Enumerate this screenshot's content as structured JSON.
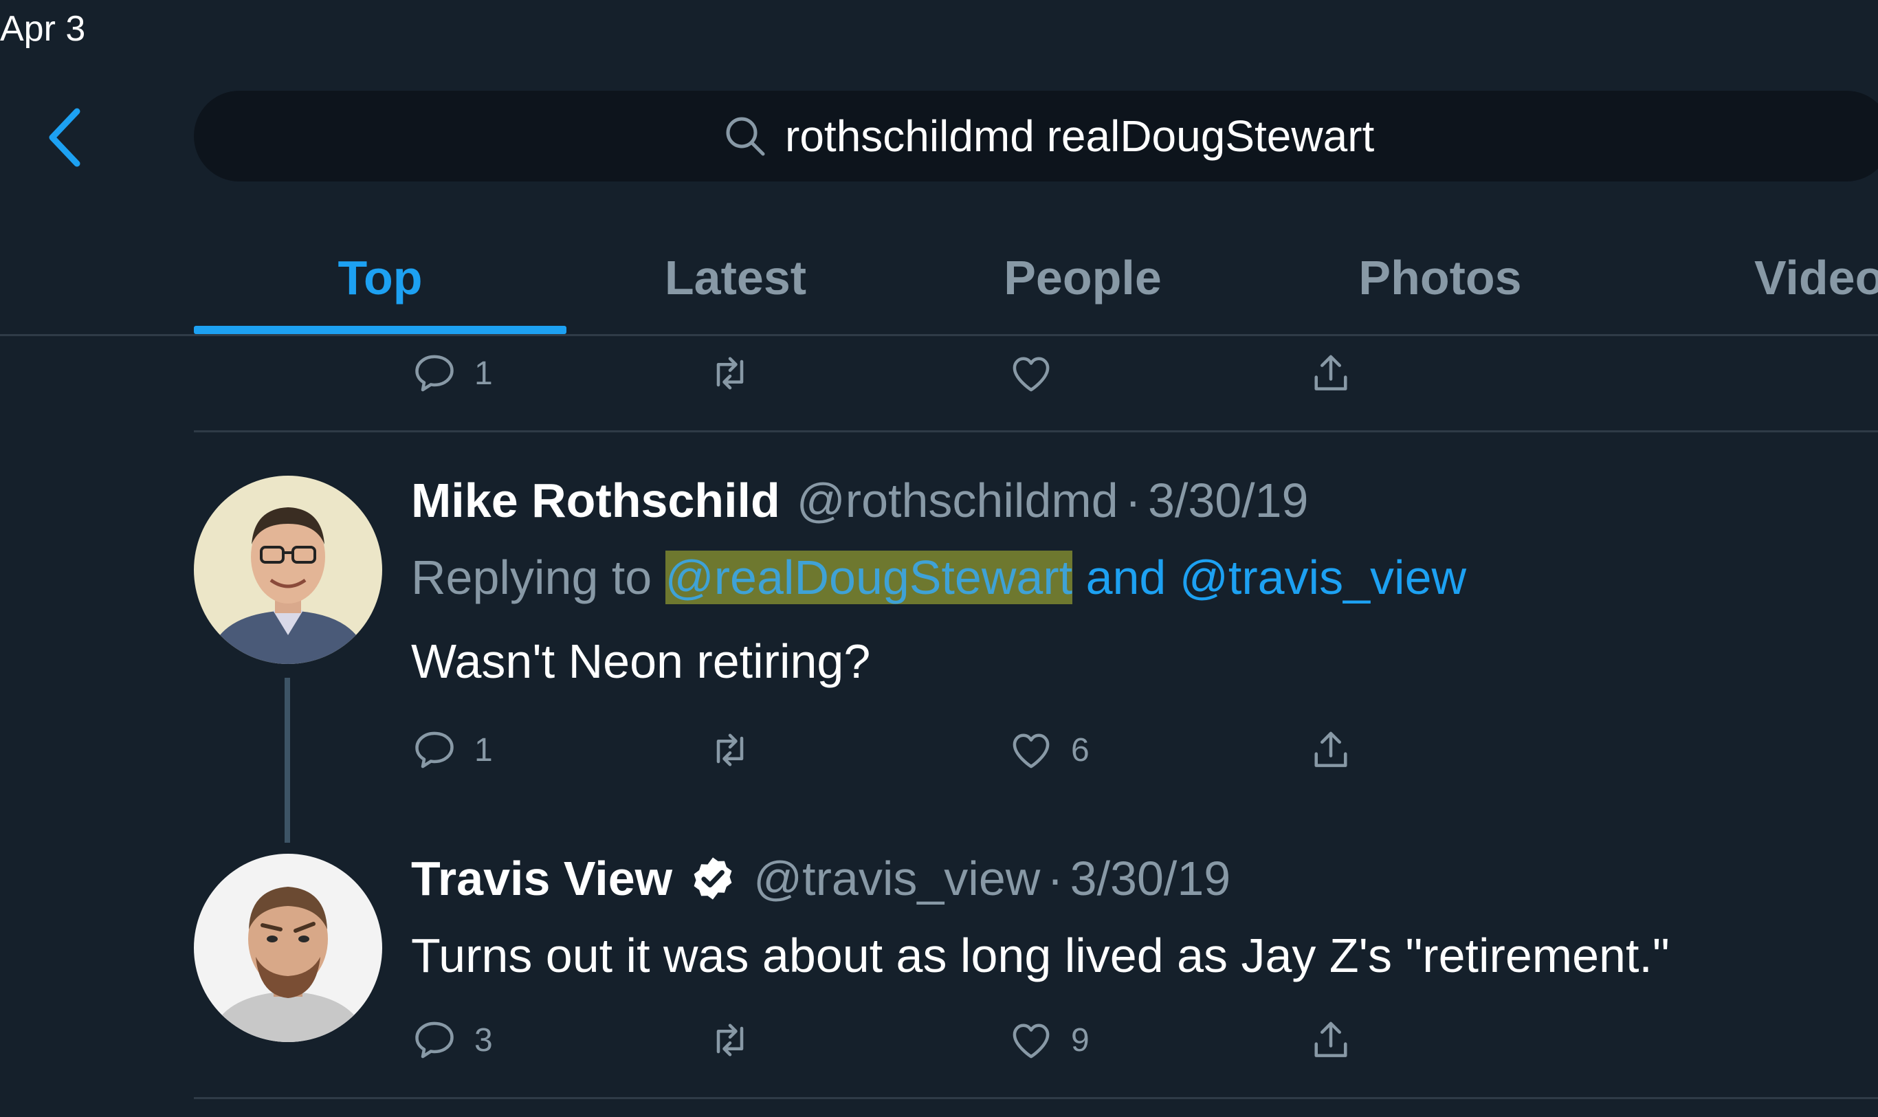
{
  "status_bar": {
    "date": "Apr 3"
  },
  "search": {
    "query": "rothschildmd realDougStewart"
  },
  "tabs": [
    {
      "label": "Top",
      "active": true
    },
    {
      "label": "Latest",
      "active": false
    },
    {
      "label": "People",
      "active": false
    },
    {
      "label": "Photos",
      "active": false
    },
    {
      "label": "Videos",
      "active": false
    }
  ],
  "previous_tweet": {
    "reply_count": "1"
  },
  "tweets": [
    {
      "name": "Mike Rothschild",
      "handle": "@rothschildmd",
      "dot": "·",
      "date": "3/30/19",
      "replying_prefix": "Replying to",
      "replying_user1": "@realDougStewart",
      "replying_and": "and",
      "replying_user2": "@travis_view",
      "text": "Wasn't Neon retiring?",
      "reply_count": "1",
      "retweet_count": "",
      "like_count": "6"
    },
    {
      "name": "Travis View",
      "verified": true,
      "handle": "@travis_view",
      "dot": "·",
      "date": "3/30/19",
      "text": "Turns out it was about as long lived as Jay Z's \"retirement.\"",
      "reply_count": "3",
      "retweet_count": "",
      "like_count": "9"
    }
  ],
  "colors": {
    "background": "#15202b",
    "accent": "#1da1f2",
    "secondary_text": "#8899a6"
  }
}
